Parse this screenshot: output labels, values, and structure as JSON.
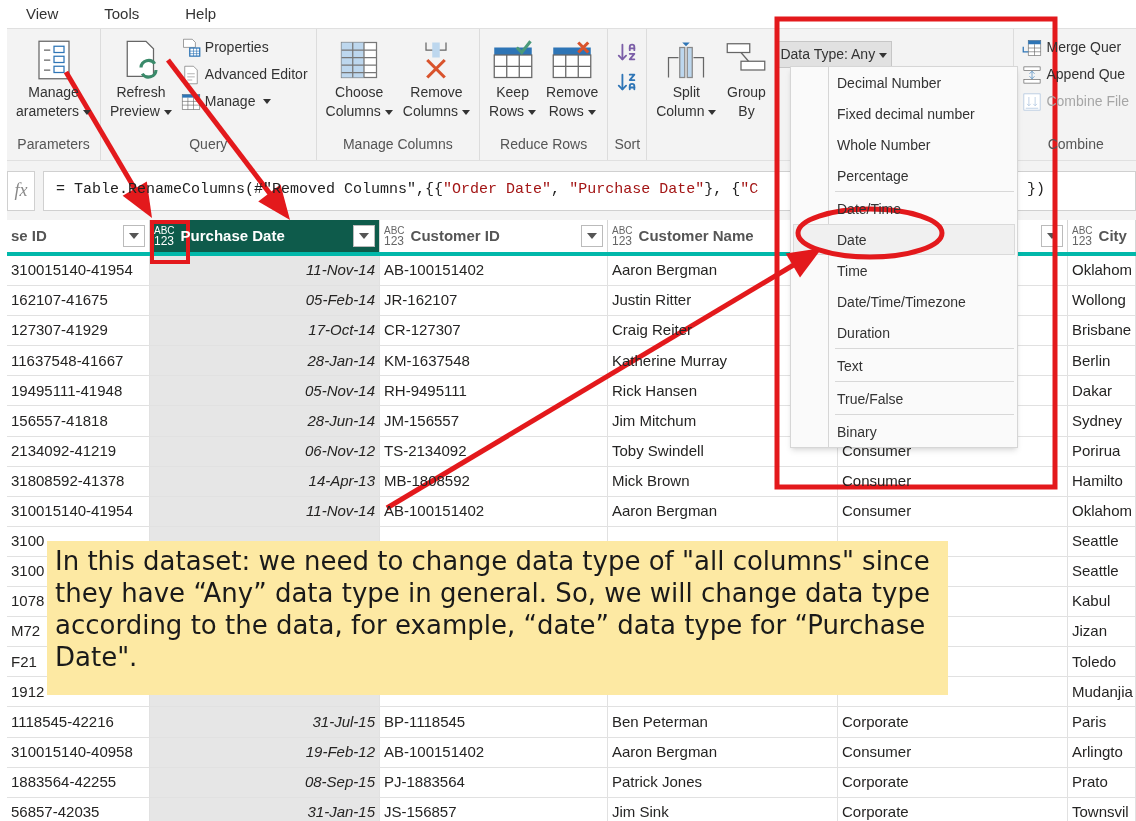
{
  "menu_bar": [
    "View",
    "Tools",
    "Help"
  ],
  "ribbon": {
    "groups": [
      {
        "label": "Parameters",
        "items": [
          {
            "kind": "large",
            "lines": [
              "Manage",
              "arameters"
            ],
            "dropdown": true
          }
        ]
      },
      {
        "label": "Query",
        "items": [
          {
            "kind": "large",
            "lines": [
              "Refresh",
              "Preview"
            ],
            "dropdown": true
          },
          {
            "kind": "stack",
            "items": [
              {
                "label": "Properties",
                "dropdown": false,
                "disabled": false
              },
              {
                "label": "Advanced Editor",
                "dropdown": false,
                "disabled": false
              },
              {
                "label": "Manage",
                "dropdown": true,
                "disabled": false
              }
            ]
          }
        ]
      },
      {
        "label": "Manage Columns",
        "items": [
          {
            "kind": "large",
            "lines": [
              "Choose",
              "Columns"
            ],
            "dropdown": true
          },
          {
            "kind": "large",
            "lines": [
              "Remove",
              "Columns"
            ],
            "dropdown": true
          }
        ]
      },
      {
        "label": "Reduce Rows",
        "items": [
          {
            "kind": "large",
            "lines": [
              "Keep",
              "Rows"
            ],
            "dropdown": true
          },
          {
            "kind": "large",
            "lines": [
              "Remove",
              "Rows"
            ],
            "dropdown": true
          }
        ]
      },
      {
        "label": "Sort",
        "items": [
          {
            "kind": "sort"
          }
        ]
      },
      {
        "items": [
          {
            "kind": "large",
            "lines": [
              "Split",
              "Column"
            ],
            "dropdown": true
          },
          {
            "kind": "large",
            "lines": [
              "Group",
              "By"
            ],
            "dropdown": false
          },
          {
            "kind": "dropdown",
            "label": "Data Type: Any",
            "expanded": true
          }
        ]
      },
      {
        "label": "Combine",
        "items": [
          {
            "kind": "stack",
            "items": [
              {
                "label": "Merge Quer",
                "dropdown": false,
                "disabled": false
              },
              {
                "label": "Append Que",
                "dropdown": false,
                "disabled": false
              },
              {
                "label": "Combine File",
                "dropdown": false,
                "disabled": true
              }
            ]
          }
        ]
      }
    ]
  },
  "formula_bar": {
    "label": "fx",
    "segments": [
      {
        "kind": "code",
        "text": "= Table.RenameColumns(#\"Removed Columns\",{{"
      },
      {
        "kind": "string",
        "text": "\"Order Date\""
      },
      {
        "kind": "code",
        "text": ", "
      },
      {
        "kind": "string",
        "text": "\"Purchase Date\""
      },
      {
        "kind": "code",
        "text": "}, {"
      },
      {
        "kind": "string",
        "text": "\"C"
      }
    ],
    "tail": "})"
  },
  "table": {
    "columns": [
      {
        "label": "se ID",
        "kind": "text",
        "filter": true,
        "selected": false
      },
      {
        "label": "Purchase Date",
        "kind": "date",
        "type_badge": [
          "ABC",
          "123"
        ],
        "filter": true,
        "selected": true
      },
      {
        "label": "Customer ID",
        "kind": "text",
        "type_badge": [
          "ABC",
          "123"
        ],
        "filter": true,
        "selected": false
      },
      {
        "label": "Customer Name",
        "kind": "text",
        "type_badge": [
          "ABC",
          "123"
        ],
        "filter": false,
        "selected": false
      },
      {
        "kind": "text",
        "filter": true,
        "selected": false
      },
      {
        "label": "City",
        "kind": "text",
        "type_badge": [
          "ABC",
          "123"
        ],
        "filter": false,
        "selected": false
      }
    ],
    "rows": [
      [
        "310015140-41954",
        "11-Nov-14",
        "AB-100151402",
        "Aaron Bergman",
        null,
        "Oklahom"
      ],
      [
        "162107-41675",
        "05-Feb-14",
        "JR-162107",
        "Justin Ritter",
        null,
        "Wollong"
      ],
      [
        "127307-41929",
        "17-Oct-14",
        "CR-127307",
        "Craig Reiter",
        null,
        "Brisbane"
      ],
      [
        "11637548-41667",
        "28-Jan-14",
        "KM-1637548",
        "Katherine Murray",
        null,
        "Berlin"
      ],
      [
        "19495111-41948",
        "05-Nov-14",
        "RH-9495111",
        "Rick Hansen",
        null,
        "Dakar"
      ],
      [
        "156557-41818",
        "28-Jun-14",
        "JM-156557",
        "Jim Mitchum",
        null,
        "Sydney"
      ],
      [
        "2134092-41219",
        "06-Nov-12",
        "TS-2134092",
        "Toby Swindell",
        "Consumer",
        "Porirua"
      ],
      [
        "31808592-41378",
        "14-Apr-13",
        "MB-1808592",
        "Mick Brown",
        "Consumer",
        "Hamilto"
      ],
      [
        "310015140-41954",
        "11-Nov-14",
        "AB-100151402",
        "Aaron Bergman",
        "Consumer",
        "Oklahom"
      ],
      [
        "3100",
        null,
        null,
        null,
        null,
        "Seattle"
      ],
      [
        "3100",
        null,
        null,
        null,
        null,
        "Seattle"
      ],
      [
        "1078",
        null,
        null,
        null,
        null,
        "Kabul"
      ],
      [
        "M72",
        null,
        null,
        null,
        null,
        "Jizan"
      ],
      [
        "F21",
        null,
        null,
        null,
        null,
        "Toledo"
      ],
      [
        "1912",
        null,
        null,
        null,
        null,
        "Mudanjia"
      ],
      [
        "1118545-42216",
        "31-Jul-15",
        "BP-1118545",
        "Ben Peterman",
        "Corporate",
        "Paris"
      ],
      [
        "310015140-40958",
        "19-Feb-12",
        "AB-100151402",
        "Aaron Bergman",
        "Consumer",
        "Arlingto"
      ],
      [
        "1883564-42255",
        "08-Sep-15",
        "PJ-1883564",
        "Patrick Jones",
        "Corporate",
        "Prato"
      ],
      [
        "56857-42035",
        "31-Jan-15",
        "JS-156857",
        "Jim Sink",
        "Corporate",
        "Townsvil"
      ]
    ]
  },
  "data_type_menu": {
    "items": [
      {
        "kind": "option",
        "label": "Decimal Number",
        "selected": false
      },
      {
        "kind": "option",
        "label": "Fixed decimal number",
        "selected": false
      },
      {
        "kind": "option",
        "label": "Whole Number",
        "selected": false
      },
      {
        "kind": "option",
        "label": "Percentage",
        "selected": false
      },
      {
        "kind": "separator"
      },
      {
        "kind": "option",
        "label": "Date/Time",
        "selected": false
      },
      {
        "kind": "option",
        "label": "Date",
        "selected": true
      },
      {
        "kind": "option",
        "label": "Time",
        "selected": false
      },
      {
        "kind": "option",
        "label": "Date/Time/Timezone",
        "selected": false
      },
      {
        "kind": "option",
        "label": "Duration",
        "selected": false
      },
      {
        "kind": "separator"
      },
      {
        "kind": "option",
        "label": "Text",
        "selected": false
      },
      {
        "kind": "separator"
      },
      {
        "kind": "option",
        "label": "True/False",
        "selected": false
      },
      {
        "kind": "separator"
      },
      {
        "kind": "option",
        "label": "Binary",
        "selected": false
      }
    ]
  },
  "note": {
    "text": "In this dataset: we need to change data type of \"all columns\" since they have “Any” data type in general. So, we will change data type according to the data, for example, “date” data type for “Purchase Date\"."
  }
}
